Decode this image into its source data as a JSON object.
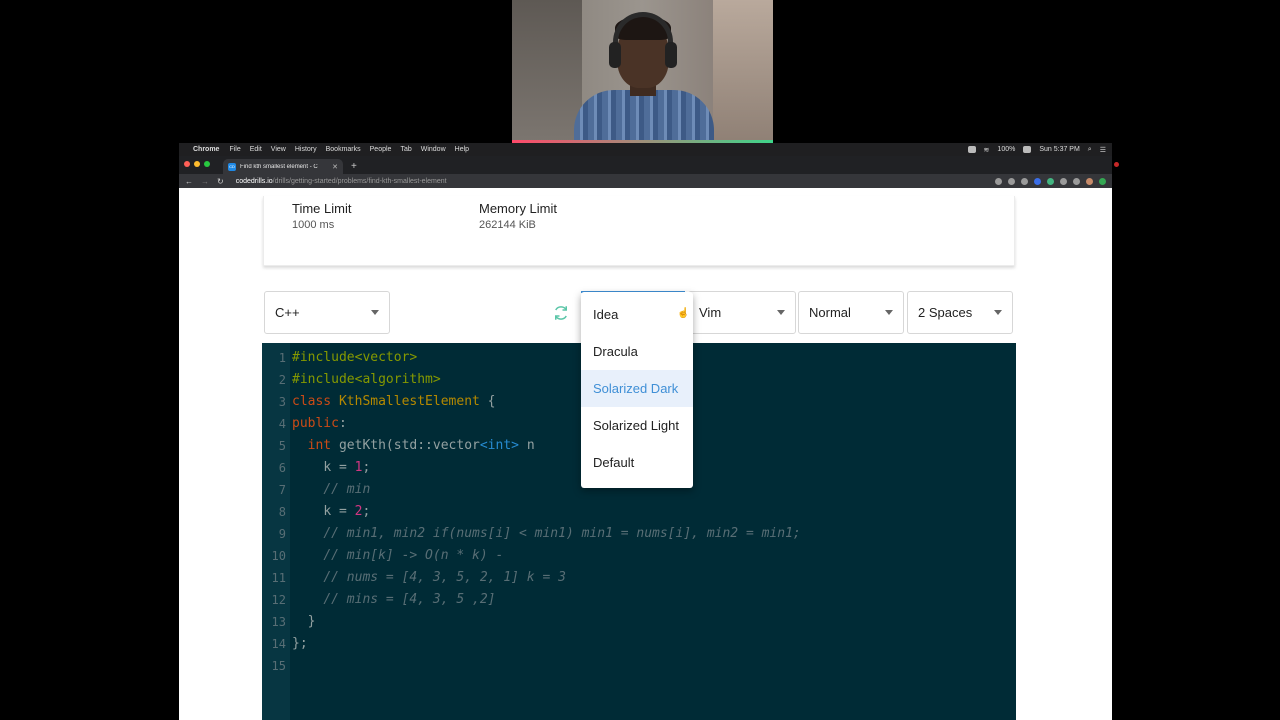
{
  "menubar": {
    "app": "Chrome",
    "items": [
      "File",
      "Edit",
      "View",
      "History",
      "Bookmarks",
      "People",
      "Tab",
      "Window",
      "Help"
    ],
    "battery": "100%",
    "clock": "Sun 5:37 PM"
  },
  "browser": {
    "tab_title": "Find kth smallest element - C",
    "tab_favicon": "CD",
    "url_domain": "codedrills.io",
    "url_path": "/drills/getting-started/problems/find-kth-smallest-element"
  },
  "limits": {
    "time_label": "Time Limit",
    "time_value": "1000 ms",
    "memory_label": "Memory Limit",
    "memory_value": "262144 KiB"
  },
  "toolbar": {
    "language": "C++",
    "keymap": "Vim",
    "mode": "Normal",
    "indent": "2 Spaces"
  },
  "theme_menu": {
    "options": [
      "Idea",
      "Dracula",
      "Solarized Dark",
      "Solarized Light",
      "Default"
    ],
    "highlighted": "Solarized Dark"
  },
  "editor": {
    "line_numbers": [
      "1",
      "2",
      "3",
      "4",
      "5",
      "6",
      "7",
      "8",
      "9",
      "10",
      "11",
      "12",
      "13",
      "14",
      "15"
    ],
    "l1": "#include<vector>",
    "l2": "#include<algorithm>",
    "l3_kw": "class",
    "l3_name": "KthSmallestElement",
    "l3_brace": " {",
    "l4_kw": "public",
    "l4_rest": ":",
    "l5_kw": "int",
    "l5_a": " getKth(std::vector",
    "l5_typ": "<int>",
    "l5_b": " n",
    "l5_c": "(",
    "l6_a": "k = ",
    "l6_num": "1",
    "l6_b": ";",
    "l7": "// min",
    "l8_a": "k = ",
    "l8_num": "2",
    "l8_b": ";",
    "l9": "// min1, min2 if(nums[i] < min1) min1 = nums[i], min2 = min1;",
    "l10": "// min[k] -> O(n * k) -",
    "l11": "// nums = [4, 3, 5, 2, 1] k = 3",
    "l12": "// mins = [4, 3, 5 ,2]",
    "l13": "}",
    "l14": "};"
  }
}
